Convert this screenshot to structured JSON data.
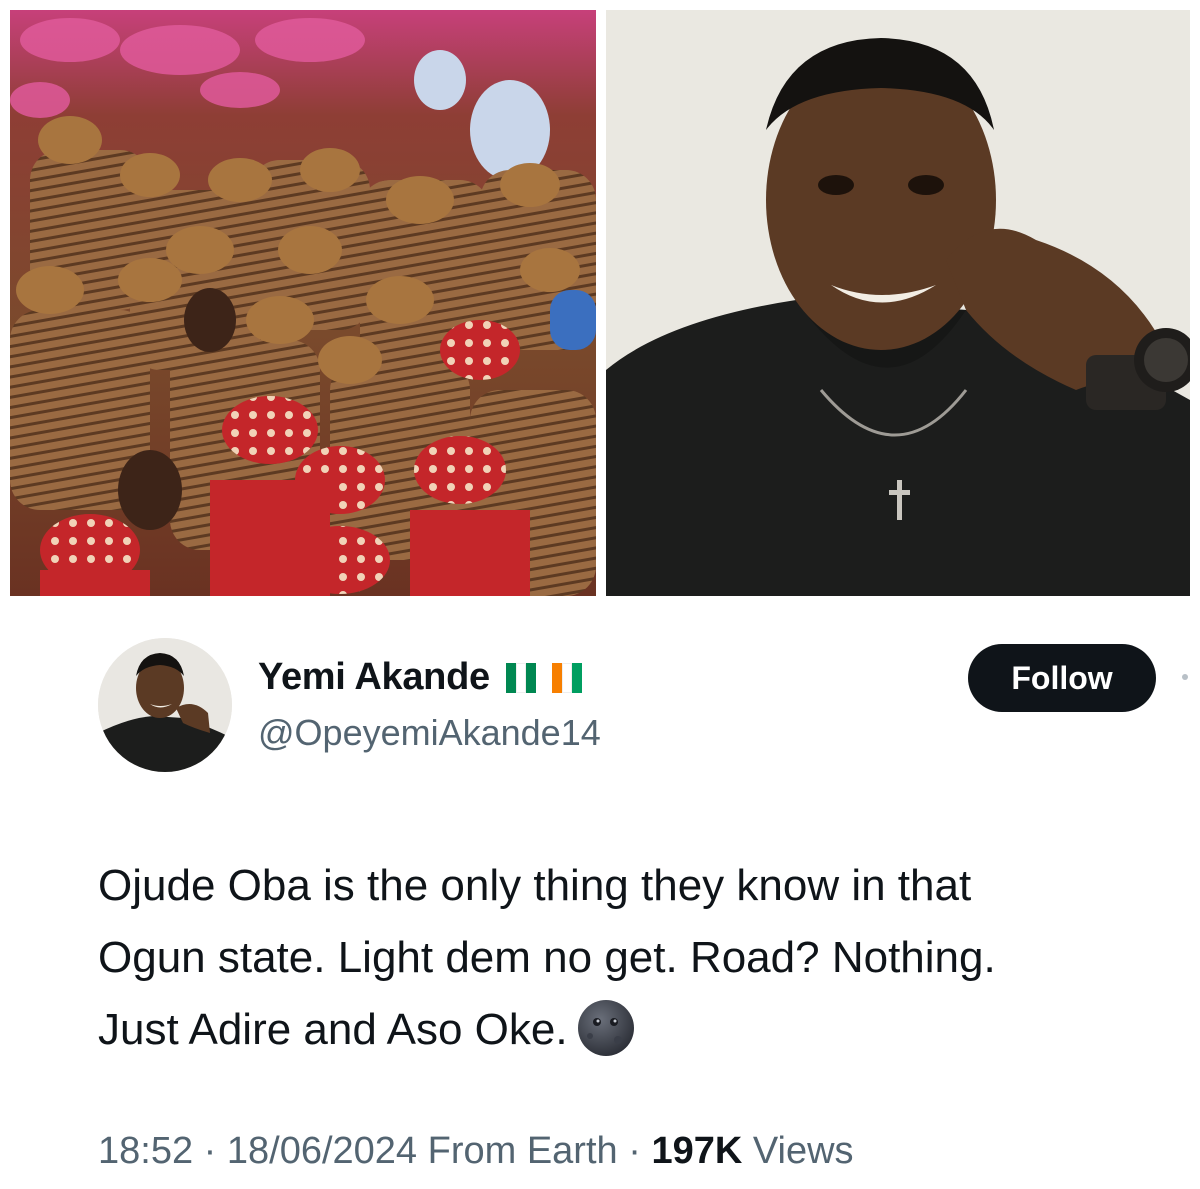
{
  "images": {
    "left_photo": "crowd-in-aso-oke-attire-photo",
    "right_photo": "smiling-man-portrait-photo"
  },
  "tweet": {
    "author": {
      "display_name": "Yemi Akande",
      "handle": "@OpeyemiAkande14",
      "flags": [
        "nigeria-flag",
        "cote-divoire-flag"
      ],
      "avatar": "profile-avatar"
    },
    "follow_label": "Follow",
    "text_lines": [
      "Ojude Oba is the only thing they know in that",
      "Ogun state. Light dem no get. Road? Nothing.",
      "Just Adire and Aso Oke."
    ],
    "emoji": "new-moon-face-emoji",
    "meta": {
      "time": "18:52",
      "separator": " · ",
      "date": "18/06/2024",
      "source": " From Earth",
      "separator2": " · ",
      "views_count": "197K",
      "views_label": " Views"
    }
  },
  "colors": {
    "text_primary": "#0f1419",
    "text_secondary": "#536471",
    "button_bg": "#0f1419",
    "nigeria_green": "#008751",
    "civ_orange": "#f77f00",
    "civ_green": "#009e60"
  }
}
